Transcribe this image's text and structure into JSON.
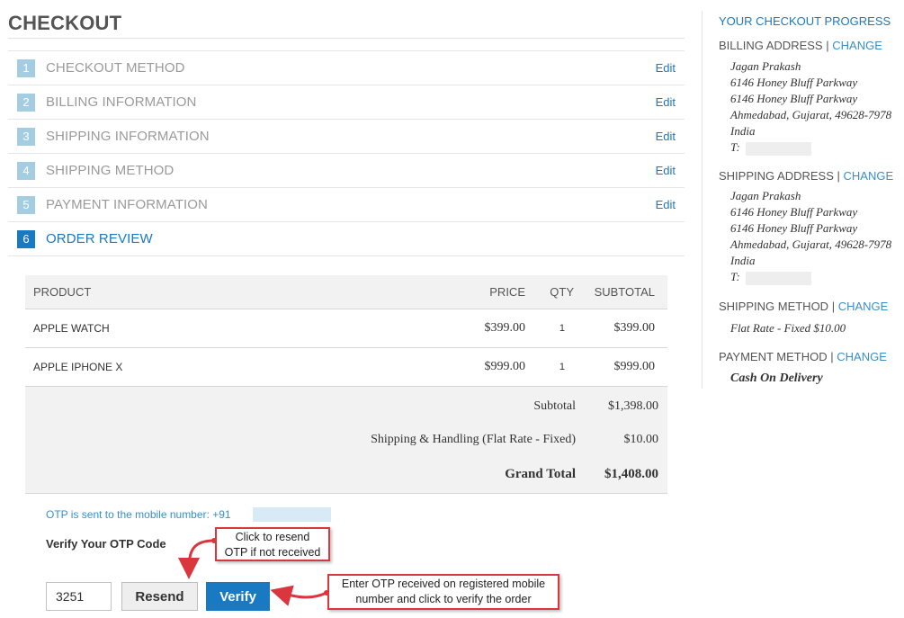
{
  "page": {
    "title": "CHECKOUT"
  },
  "steps": [
    {
      "num": "1",
      "label": "CHECKOUT METHOD",
      "edit": "Edit"
    },
    {
      "num": "2",
      "label": "BILLING INFORMATION",
      "edit": "Edit"
    },
    {
      "num": "3",
      "label": "SHIPPING INFORMATION",
      "edit": "Edit"
    },
    {
      "num": "4",
      "label": "SHIPPING METHOD",
      "edit": "Edit"
    },
    {
      "num": "5",
      "label": "PAYMENT INFORMATION",
      "edit": "Edit"
    },
    {
      "num": "6",
      "label": "ORDER REVIEW",
      "active": true
    }
  ],
  "review": {
    "headers": {
      "product": "PRODUCT",
      "price": "PRICE",
      "qty": "QTY",
      "subtotal": "SUBTOTAL"
    },
    "items": [
      {
        "product": "APPLE WATCH",
        "price": "$399.00",
        "qty": "1",
        "subtotal": "$399.00"
      },
      {
        "product": "APPLE IPHONE X",
        "price": "$999.00",
        "qty": "1",
        "subtotal": "$999.00"
      }
    ],
    "totals": {
      "subtotal_label": "Subtotal",
      "subtotal": "$1,398.00",
      "shipping_label": "Shipping & Handling (Flat Rate - Fixed)",
      "shipping": "$10.00",
      "grand_label": "Grand Total",
      "grand": "$1,408.00"
    }
  },
  "otp": {
    "message": "OTP is sent to the mobile number: +91",
    "verify_label": "Verify Your OTP Code",
    "code_value": "3251",
    "resend_label": "Resend",
    "verify_button": "Verify"
  },
  "callouts": {
    "resend": [
      "Click to resend",
      "OTP if not received"
    ],
    "verify": [
      "Enter OTP received on registered mobile",
      "number and click to verify the order"
    ]
  },
  "sidebar": {
    "title": "YOUR CHECKOUT PROGRESS",
    "billing": {
      "heading": "BILLING ADDRESS",
      "change": "CHANGE",
      "name": "Jagan Prakash",
      "line1": "6146 Honey Bluff Parkway",
      "line2": "6146 Honey Bluff Parkway",
      "city": "Ahmedabad, Gujarat, 49628-7978",
      "country": "India",
      "phone_label": "T:"
    },
    "shipping": {
      "heading": "SHIPPING ADDRESS",
      "change": "CHANGE",
      "name": "Jagan Prakash",
      "line1": "6146 Honey Bluff Parkway",
      "line2": "6146 Honey Bluff Parkway",
      "city": "Ahmedabad, Gujarat, 49628-7978",
      "country": "India",
      "phone_label": "T:"
    },
    "shipping_method": {
      "heading": "SHIPPING METHOD",
      "change": "CHANGE",
      "value": "Flat Rate - Fixed $10.00"
    },
    "payment_method": {
      "heading": "PAYMENT METHOD",
      "change": "CHANGE",
      "value": "Cash On Delivery"
    },
    "separator": "|"
  },
  "colors": {
    "accent": "#1979c3",
    "step_inactive": "#a5cde1",
    "callout_border": "#d9363e"
  }
}
